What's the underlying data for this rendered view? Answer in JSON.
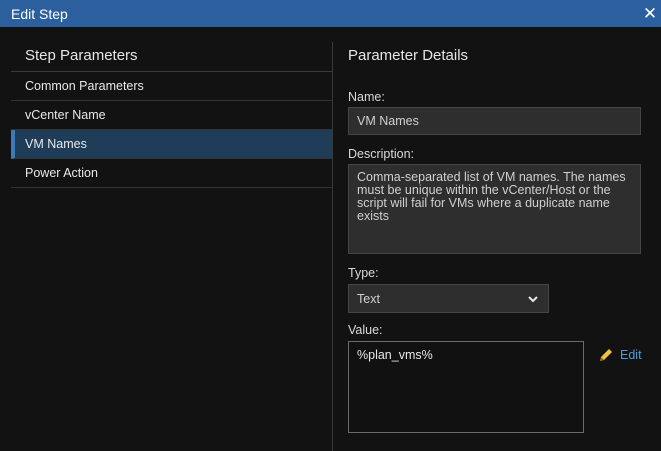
{
  "dialog": {
    "title": "Edit Step",
    "close_icon": "close-icon"
  },
  "step_parameters": {
    "heading": "Step Parameters",
    "items": [
      {
        "label": "Common Parameters",
        "active": false
      },
      {
        "label": "vCenter Name",
        "active": false
      },
      {
        "label": "VM Names",
        "active": true
      },
      {
        "label": "Power Action",
        "active": false
      }
    ]
  },
  "details": {
    "heading": "Parameter Details",
    "name_label": "Name:",
    "name_value": "VM Names",
    "description_label": "Description:",
    "description_value": "Comma-separated list of VM names. The names must be unique within the vCenter/Host or the script will fail for VMs where a duplicate name exists",
    "type_label": "Type:",
    "type_value": "Text",
    "value_label": "Value:",
    "value_value": "%plan_vms%",
    "edit_label": "Edit"
  },
  "colors": {
    "titlebar": "#2b5f9e",
    "background": "#121212",
    "selected_item": "#1f3c58",
    "link": "#4a9fe0",
    "pencil": "#f0c040"
  }
}
